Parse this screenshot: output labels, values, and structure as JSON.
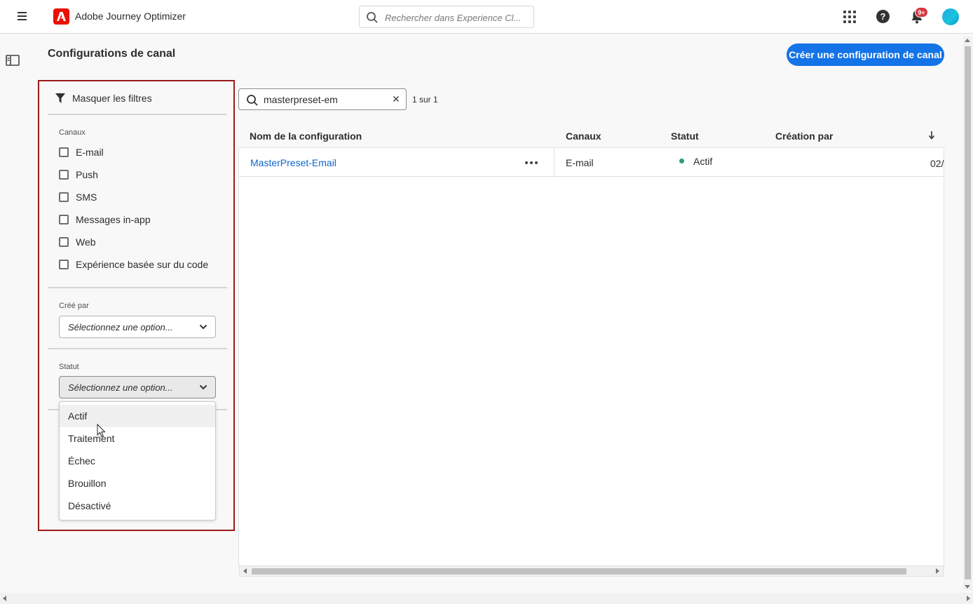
{
  "header": {
    "app_title": "Adobe Journey Optimizer",
    "search_placeholder": "Rechercher dans Experience Cl...",
    "notification_count": "9+",
    "brand_color": "#eb1000",
    "icons": [
      "menu-icon",
      "adobe-logo",
      "search-icon",
      "apps-icon",
      "help-icon",
      "bell-icon",
      "avatar"
    ]
  },
  "page": {
    "title": "Configurations de canal",
    "create_button": "Créer une configuration de canal",
    "accent_color": "#1473e6"
  },
  "filters": {
    "toggle_label": "Masquer les filtres",
    "channels": {
      "label": "Canaux",
      "options": [
        "E-mail",
        "Push",
        "SMS",
        "Messages in-app",
        "Web",
        "Expérience basée sur du code"
      ]
    },
    "created_by": {
      "label": "Créé par",
      "placeholder": "Sélectionnez une option..."
    },
    "status": {
      "label": "Statut",
      "placeholder": "Sélectionnez une option...",
      "options": [
        "Actif",
        "Traitement",
        "Échec",
        "Brouillon",
        "Désactivé"
      ]
    }
  },
  "results": {
    "search_value": "masterpreset-em",
    "count": "1 sur 1",
    "columns": [
      "Nom de la configuration",
      "Canaux",
      "Statut",
      "Création par"
    ],
    "rows": [
      {
        "name": "MasterPreset-Email",
        "channel": "E-mail",
        "status": "Actif",
        "created_by": "",
        "date_partial": "02/"
      }
    ],
    "status_active_color": "#2d9d78"
  }
}
